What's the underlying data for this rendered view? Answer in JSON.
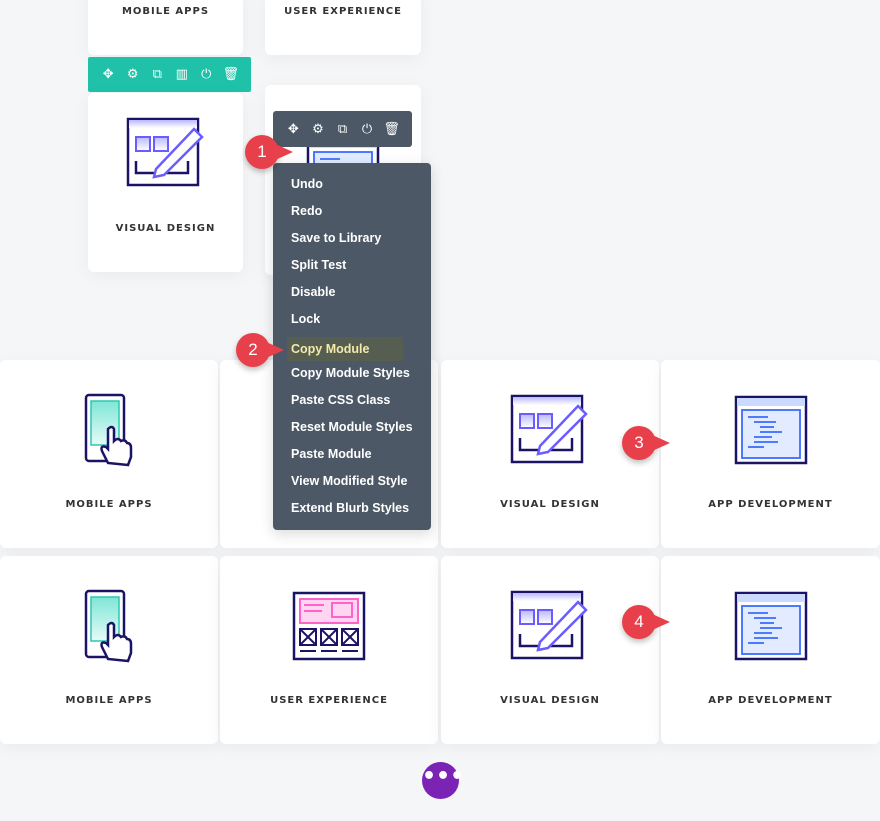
{
  "top_cards": [
    {
      "label": "MOBILE APPS"
    },
    {
      "label": "USER EXPERIENCE"
    }
  ],
  "selected_card": {
    "label": "VISUAL DESIGN"
  },
  "row_toolbar": {
    "color": "#1fc2a8",
    "icons": [
      "move-icon",
      "settings-icon",
      "duplicate-icon",
      "columns-icon",
      "save-icon",
      "delete-icon"
    ]
  },
  "module_toolbar": {
    "color": "#4c5866",
    "icons": [
      "move-icon",
      "settings-icon",
      "duplicate-icon",
      "save-icon",
      "delete-icon"
    ]
  },
  "context_menu": {
    "items": [
      "Undo",
      "Redo",
      "Save to Library",
      "Split Test",
      "Disable",
      "Lock",
      "Copy Module",
      "Copy Module Styles",
      "Paste CSS Class",
      "Reset Module Styles",
      "Paste Module",
      "View Modified Style",
      "Extend Blurb Styles"
    ],
    "highlighted": "Copy Module"
  },
  "badges": [
    "1",
    "2",
    "3",
    "4"
  ],
  "rows": [
    [
      "MOBILE APPS",
      "",
      "VISUAL DESIGN",
      "APP DEVELOPMENT"
    ],
    [
      "MOBILE APPS",
      "USER EXPERIENCE",
      "VISUAL DESIGN",
      "APP DEVELOPMENT"
    ]
  ],
  "more_button": {
    "label": "•••",
    "color": "#7b23b5"
  },
  "badge_color": "#e8404a"
}
